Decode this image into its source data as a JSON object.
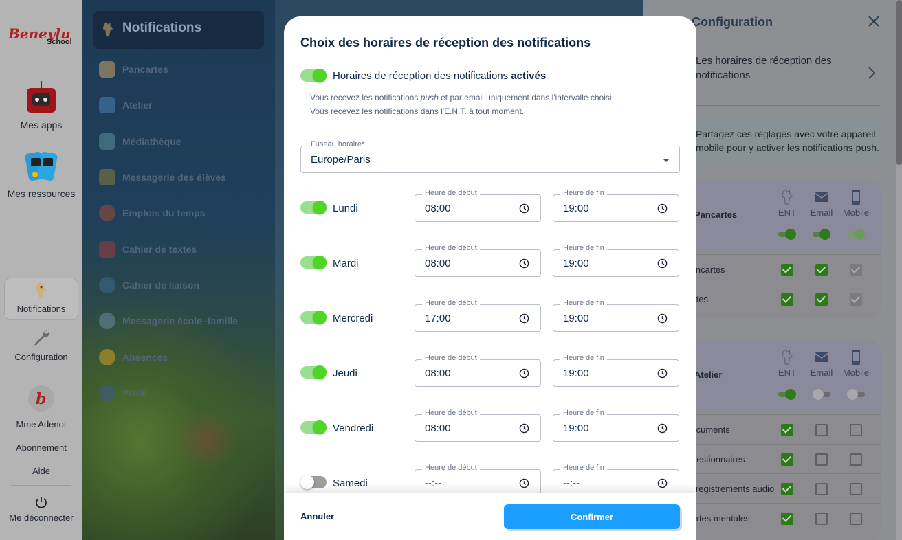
{
  "appbar": {
    "logo_text": "Beneylu School",
    "items": [
      {
        "label": "Mes apps"
      },
      {
        "label": "Mes ressources"
      },
      {
        "label": "Notifications"
      },
      {
        "label": "Configuration"
      },
      {
        "label": "Mme Adenot"
      },
      {
        "label": "Abonnement"
      },
      {
        "label": "Aide"
      },
      {
        "label": "Me déconnecter"
      }
    ]
  },
  "menu": {
    "active": "Notifications",
    "items": [
      {
        "label": "Pancartes",
        "color": "#c9a46a"
      },
      {
        "label": "Atelier",
        "color": "#4a7fb0"
      },
      {
        "label": "Médiathèque",
        "color": "#5a8f9a"
      },
      {
        "label": "Messagerie des élèves",
        "color": "#8a7a3a"
      },
      {
        "label": "Emplois du temps",
        "color": "#a04a3a"
      },
      {
        "label": "Cahier de textes",
        "color": "#a03a3a"
      },
      {
        "label": "Cahier de liaison",
        "color": "#3a6a8a"
      },
      {
        "label": "Messagerie école–famille",
        "color": "#6a8aa0"
      },
      {
        "label": "Absences",
        "color": "#c8a028"
      },
      {
        "label": "Profil",
        "color": "#3a5a8a"
      }
    ]
  },
  "config": {
    "title": "Configuration",
    "row_text": "Les horaires de réception des notifications",
    "info_line1": "Partagez ces réglages avec votre appareil",
    "info_line2": "mobile pour y activer les notifications push.",
    "columns": [
      "ENT",
      "Email",
      "Mobile"
    ],
    "groups": [
      {
        "title": "Pancartes",
        "rows": [
          "Pancartes",
          "Notes"
        ]
      },
      {
        "title": "Atelier",
        "rows": [
          "Documents",
          "Questionnaires",
          "Enregistrements audio",
          "Cartes mentales"
        ]
      }
    ]
  },
  "modal": {
    "title": "Choix des horaires de réception des notifications",
    "master_label": "Horaires de réception des notifications",
    "master_state": "activés",
    "desc_line1_a": "Vous recevez les notifications ",
    "desc_line1_em": "push",
    "desc_line1_b": " et par email uniquement dans l'intervalle choisi.",
    "desc_line2": "Vous recevez les notifications dans l'E.N.T. à tout moment.",
    "timezone_label": "Fuseau horaire*",
    "timezone_value": "Europe/Paris",
    "start_label": "Heure de début",
    "end_label": "Heure de fin",
    "days": [
      {
        "name": "Lundi",
        "enabled": true,
        "start": "08:00",
        "end": "19:00"
      },
      {
        "name": "Mardi",
        "enabled": true,
        "start": "08:00",
        "end": "19:00"
      },
      {
        "name": "Mercredi",
        "enabled": true,
        "start": "17:00",
        "end": "19:00"
      },
      {
        "name": "Jeudi",
        "enabled": true,
        "start": "08:00",
        "end": "19:00"
      },
      {
        "name": "Vendredi",
        "enabled": true,
        "start": "08:00",
        "end": "19:00"
      },
      {
        "name": "Samedi",
        "enabled": false,
        "start": "--:--",
        "end": "--:--"
      }
    ],
    "cancel_label": "Annuler",
    "confirm_label": "Confirmer"
  }
}
